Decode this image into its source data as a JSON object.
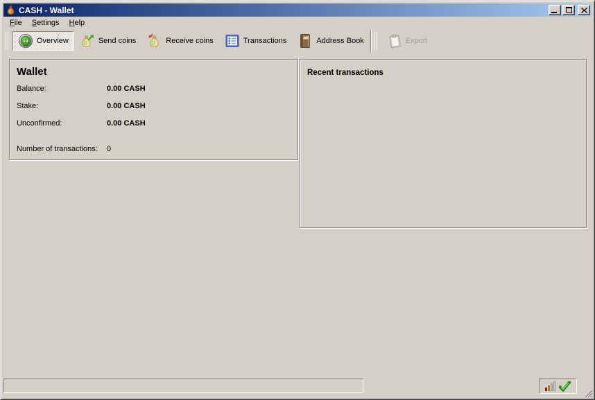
{
  "colors": {
    "window_bg": "#d4d0c8",
    "titlebar_gradient_left": "#0a246a",
    "titlebar_gradient_right": "#a6caf0",
    "title_text": "#ffffff",
    "border_dark": "#808080",
    "border_light": "#ffffff",
    "disabled_text": "#a09c92",
    "sync_check_green": "#2fa41f",
    "connection_bar_red": "#b03425",
    "connection_bar_amber": "#e0a33c"
  },
  "window": {
    "title": "CASH - Wallet",
    "app_icon": "money-bag-icon",
    "controls": {
      "minimize": "minimize-icon",
      "maximize": "maximize-icon",
      "close": "close-icon"
    }
  },
  "menubar": {
    "items": [
      {
        "label": "File"
      },
      {
        "label": "Settings"
      },
      {
        "label": "Help"
      }
    ]
  },
  "toolbar": {
    "buttons": [
      {
        "label": "Overview",
        "icon": "overview-coin-icon",
        "active": true
      },
      {
        "label": "Send coins",
        "icon": "send-moneybag-icon",
        "active": false
      },
      {
        "label": "Receive coins",
        "icon": "receive-moneybag-icon",
        "active": false
      },
      {
        "label": "Transactions",
        "icon": "transactions-list-icon",
        "active": false
      },
      {
        "label": "Address Book",
        "icon": "address-book-icon",
        "active": false
      }
    ],
    "export_button": {
      "label": "Export",
      "icon": "export-clipboard-icon",
      "enabled": false
    }
  },
  "wallet_panel": {
    "title": "Wallet",
    "rows": [
      {
        "label": "Balance:",
        "value": "0.00 CASH"
      },
      {
        "label": "Stake:",
        "value": "0.00 CASH"
      },
      {
        "label": "Unconfirmed:",
        "value": "0.00 CASH"
      }
    ],
    "transactions_row": {
      "label": "Number of transactions:",
      "value": "0"
    }
  },
  "recent_panel": {
    "title": "Recent transactions"
  },
  "statusbar": {
    "message": "",
    "connections_icon": "connections-bars-icon",
    "sync_icon": "sync-check-icon"
  }
}
